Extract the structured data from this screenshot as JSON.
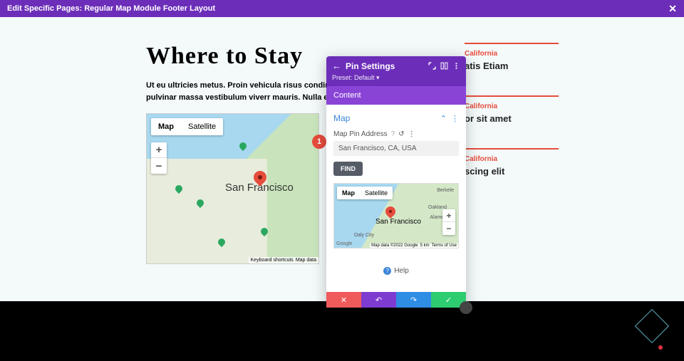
{
  "topbar": {
    "title": "Edit Specific Pages: Regular Map Module Footer Layout"
  },
  "page": {
    "heading": "Where to Stay",
    "body": "Ut eu ultricies metus. Proin vehicula risus condimentum molestie. Integer in elit pulvinar massa vestibulum viverr mauris. Nulla eget ante vitae mi tempor luctus."
  },
  "badge": "1",
  "main_map": {
    "tab_map": "Map",
    "tab_sat": "Satellite",
    "city_label": "San Francisco",
    "footer_shortcuts": "Keyboard shortcuts",
    "footer_data": "Map data"
  },
  "cards": [
    {
      "loc": "California",
      "title": "atis Etiam"
    },
    {
      "loc": "California",
      "title": "or sit amet"
    },
    {
      "loc": "California",
      "title": "scing elit"
    }
  ],
  "modal": {
    "title": "Pin Settings",
    "preset": "Preset: Default",
    "tab": "Content",
    "section": "Map",
    "addr_label": "Map Pin Address",
    "addr_value": "San Francisco, CA, USA",
    "find": "FIND",
    "mini": {
      "tab_map": "Map",
      "tab_sat": "Satellite",
      "city": "San Francisco",
      "berkeley": "Berkele",
      "oakland": "Oakland",
      "alameda": "Alameda",
      "dalycity": "Daly City",
      "google": "Google",
      "attrib": "Map data ©2022 Google",
      "scale": "5 km",
      "terms": "Terms of Use"
    },
    "help": "Help"
  }
}
